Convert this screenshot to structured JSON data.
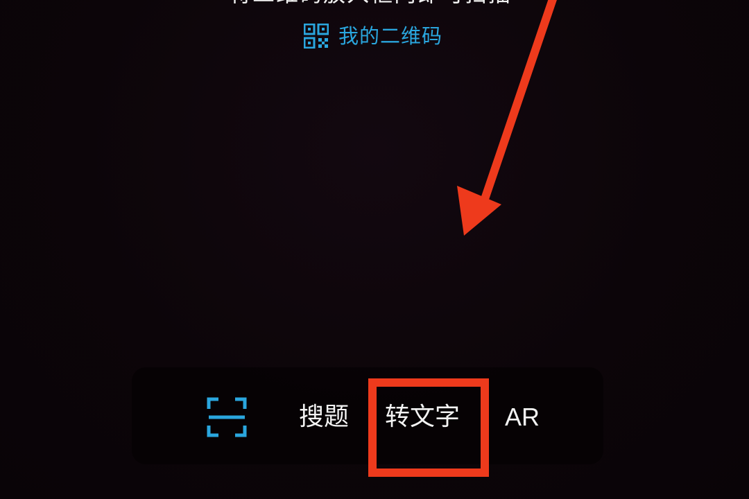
{
  "top_hint": "将二维码放入框内即可扫描",
  "qr_link": {
    "label": "我的二维码",
    "icon": "qr-code-icon"
  },
  "modes": [
    {
      "label": "",
      "icon": "scan-frame-icon",
      "active": true
    },
    {
      "label": "搜题"
    },
    {
      "label": "转文字",
      "highlighted": true
    },
    {
      "label": "AR"
    }
  ],
  "colors": {
    "accent": "#2aa6de",
    "annotation": "#ee3a1c",
    "text": "#f3f3f3",
    "background": "#0b0408"
  }
}
